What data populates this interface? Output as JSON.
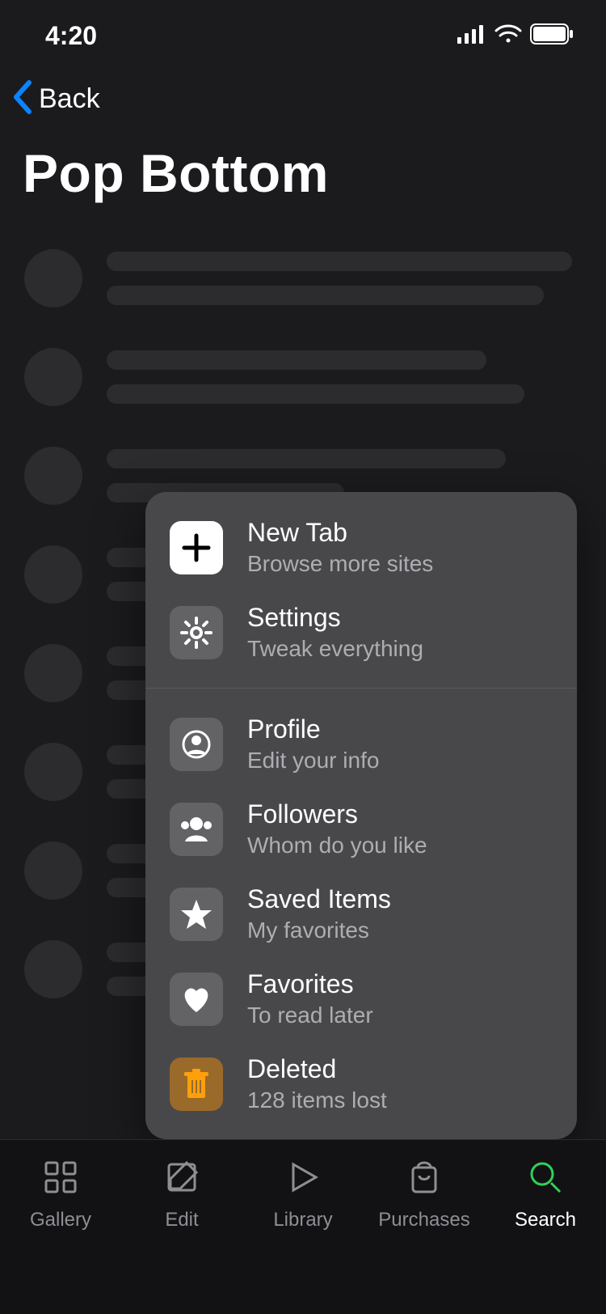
{
  "status": {
    "time": "4:20"
  },
  "nav": {
    "back_label": "Back"
  },
  "page": {
    "title": "Pop Bottom"
  },
  "popup": {
    "section1": [
      {
        "icon": "plus",
        "title": "New Tab",
        "subtitle": "Browse more sites"
      },
      {
        "icon": "gear",
        "title": "Settings",
        "subtitle": "Tweak everything"
      }
    ],
    "section2": [
      {
        "icon": "profile",
        "title": "Profile",
        "subtitle": "Edit your info"
      },
      {
        "icon": "group",
        "title": "Followers",
        "subtitle": "Whom do you like"
      },
      {
        "icon": "star",
        "title": "Saved Items",
        "subtitle": "My favorites"
      },
      {
        "icon": "heart",
        "title": "Favorites",
        "subtitle": "To read later"
      },
      {
        "icon": "trash",
        "title": "Deleted",
        "subtitle": "128 items lost"
      }
    ]
  },
  "tabs": [
    {
      "label": "Gallery"
    },
    {
      "label": "Edit"
    },
    {
      "label": "Library"
    },
    {
      "label": "Purchases"
    },
    {
      "label": "Search"
    }
  ]
}
